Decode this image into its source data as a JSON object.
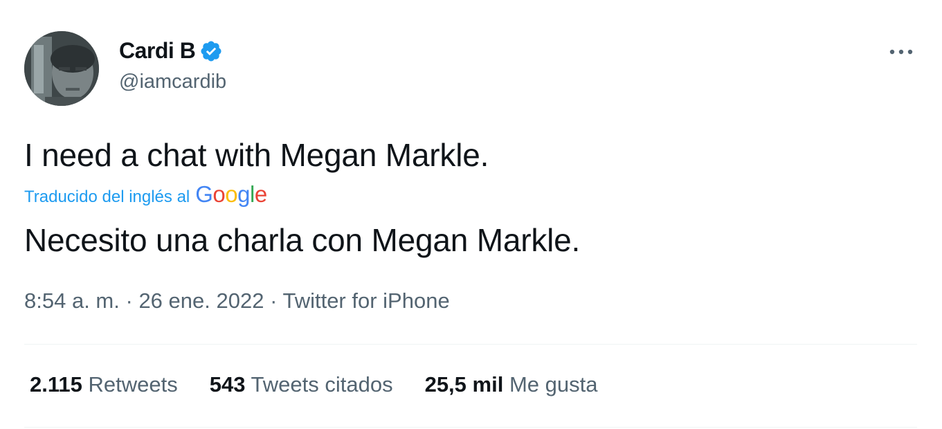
{
  "author": {
    "display_name": "Cardi B",
    "handle": "@iamcardib",
    "verified": true
  },
  "tweet": {
    "text": "I need a chat with Megan Markle.",
    "translation_label": "Traducido del inglés al",
    "translation_provider": "Google",
    "translated_text": "Necesito una charla con Megan Markle.",
    "time": "8:54 a. m.",
    "separator": "·",
    "date": "26 ene. 2022",
    "source": "Twitter for iPhone"
  },
  "stats": {
    "retweets_count": "2.115",
    "retweets_label": "Retweets",
    "quotes_count": "543",
    "quotes_label": "Tweets citados",
    "likes_count": "25,5 mil",
    "likes_label": "Me gusta"
  },
  "colors": {
    "accent": "#1d9bf0",
    "text": "#0f1419",
    "secondary": "#536471"
  }
}
